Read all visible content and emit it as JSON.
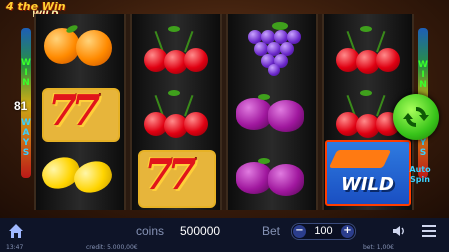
{
  "logo": {
    "brand": "4 the Win",
    "sub": "WILD"
  },
  "side": {
    "win_label": [
      "W",
      "I",
      "N"
    ],
    "ways_label": [
      "W",
      "A",
      "Y",
      "S"
    ],
    "ways_count": "81"
  },
  "reels": [
    [
      "orange",
      "seven",
      "lemon"
    ],
    [
      "cherry",
      "cherry",
      "seven"
    ],
    [
      "grape",
      "plum",
      "plum"
    ],
    [
      "cherry",
      "cherry",
      "wild"
    ]
  ],
  "wild_text": "WILD",
  "buttons": {
    "auto_spin": "Auto Spin"
  },
  "bar": {
    "coins_label": "coins",
    "coins_value": "500000",
    "bet_label": "Bet",
    "bet_value": "100",
    "minus": "−",
    "plus": "+"
  },
  "footer": {
    "time": "13:47",
    "credit": "credit: 5.000,00€",
    "bet": "bet: 1,00€"
  },
  "colors": {
    "win_green": "#3aff2a",
    "ways_blue": "#3ad0ff",
    "bar_bg": "#0e1428"
  }
}
